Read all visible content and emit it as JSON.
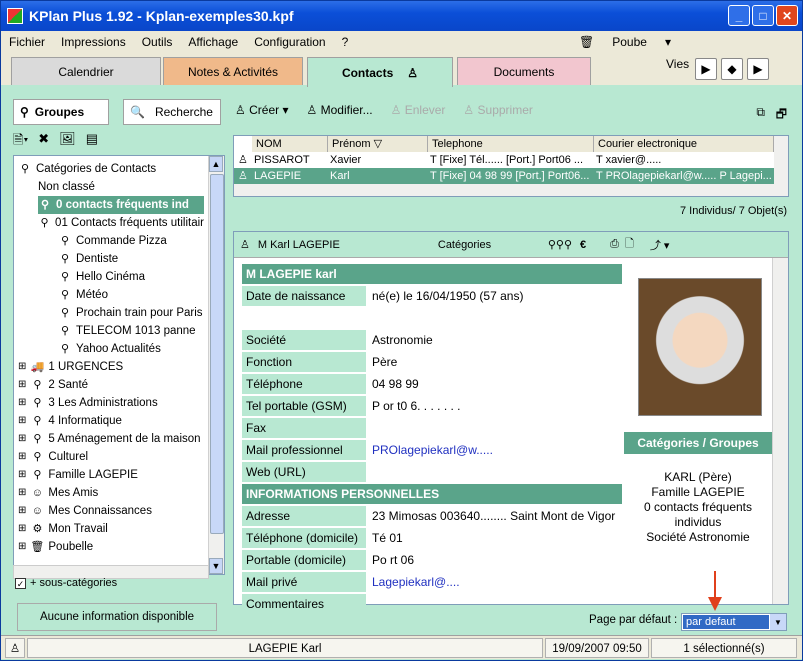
{
  "title": "KPlan Plus 1.92 - Kplan-exemples30.kpf",
  "menu": [
    "Fichier",
    "Impressions",
    "Outils",
    "Affichage",
    "Configuration",
    "?"
  ],
  "menu_right": {
    "poubelle": "Poube",
    "arrow": "▾"
  },
  "tabs": [
    "Calendrier",
    "Notes & Activités",
    "Contacts",
    "Documents"
  ],
  "vues_label": "Vies",
  "left": {
    "tab_groupes": "Groupes",
    "tab_recherche": "Recherche",
    "tree": [
      {
        "label": "Catégories de Contacts",
        "level": 0,
        "icon": "tag-icon"
      },
      {
        "label": "Non classé",
        "level": 1,
        "icon": ""
      },
      {
        "label": "0 contacts fréquents ind",
        "level": 1,
        "icon": "tag-icon",
        "selected": true
      },
      {
        "label": "01 Contacts  fréquents utilitair",
        "level": 1,
        "icon": "tag-icon"
      },
      {
        "label": "Commande Pizza",
        "level": 2,
        "icon": "tag-icon"
      },
      {
        "label": "Dentiste",
        "level": 2,
        "icon": "tag-icon"
      },
      {
        "label": "Hello Cinéma",
        "level": 2,
        "icon": "tag-icon"
      },
      {
        "label": "Météo",
        "level": 2,
        "icon": "tag-icon"
      },
      {
        "label": "Prochain train pour Paris",
        "level": 2,
        "icon": "tag-icon"
      },
      {
        "label": "TELECOM 1013  panne",
        "level": 2,
        "icon": "tag-icon"
      },
      {
        "label": "Yahoo Actualités",
        "level": 2,
        "icon": "tag-icon"
      },
      {
        "label": "1 URGENCES",
        "level": 0,
        "icon": "truck-icon"
      },
      {
        "label": "2 Santé",
        "level": 0,
        "icon": "tag-icon"
      },
      {
        "label": "3  Les Administrations",
        "level": 0,
        "icon": "tag-icon"
      },
      {
        "label": "4 Informatique",
        "level": 0,
        "icon": "tag-icon"
      },
      {
        "label": "5 Aménagement de la maison",
        "level": 0,
        "icon": "tag-icon"
      },
      {
        "label": "Culturel",
        "level": 0,
        "icon": "tag-icon"
      },
      {
        "label": "Famille LAGEPIE",
        "level": 0,
        "icon": "tag-icon"
      },
      {
        "label": "Mes Amis",
        "level": 0,
        "icon": "people-icon"
      },
      {
        "label": "Mes Connaissances",
        "level": 0,
        "icon": "people-icon"
      },
      {
        "label": "Mon Travail",
        "level": 0,
        "icon": "gear-icon"
      },
      {
        "label": "Poubelle",
        "level": 0,
        "icon": "trash-icon"
      }
    ],
    "subcat_label": "+ sous-catégories",
    "no_info": "Aucune information disponible"
  },
  "toolbar": {
    "creer": "Créer",
    "modifier": "Modifier...",
    "enlever": "Enlever",
    "supprimer": "Supprimer"
  },
  "list": {
    "headers": [
      "NOM",
      "Prénom",
      "Telephone",
      "Courier electronique"
    ],
    "rows": [
      {
        "nom": "PISSAROT",
        "prenom": "Xavier",
        "tel": "T [Fixe] Tél...... [Port.] Port06 ...",
        "mail": "T xavier@....."
      },
      {
        "nom": "LAGEPIE",
        "prenom": "Karl",
        "tel": "T [Fixe] 04 98 99 [Port.] Port06...",
        "mail": "T PROlagepiekarl@w..... P Lagepi..."
      }
    ],
    "count": "7 Individus/ 7 Objet(s)"
  },
  "card": {
    "header_name": "M Karl LAGEPIE",
    "header_cat": "Catégories",
    "header_euro": "€",
    "title": "M LAGEPIE karl",
    "fields": [
      {
        "label": "Date de naissance",
        "value": "né(e) le 16/04/1950 (57 ans)"
      },
      {
        "label": "Société",
        "value": "Astronomie"
      },
      {
        "label": "Fonction",
        "value": "Père"
      },
      {
        "label": "Téléphone",
        "value": "04 98 99"
      },
      {
        "label": "Tel portable (GSM)",
        "value": "P or t0 6. . .  . . . ."
      },
      {
        "label": "Fax",
        "value": ""
      },
      {
        "label": "Mail professionnel",
        "value": "PROlagepiekarl@w....."
      },
      {
        "label": "Web (URL)",
        "value": ""
      }
    ],
    "perso_header": "INFORMATIONS PERSONNELLES",
    "perso": [
      {
        "label": "Adresse",
        "value": "23 Mimosas 003640........ Saint Mont de Vigor"
      },
      {
        "label": "Téléphone (domicile)",
        "value": "Té 01"
      },
      {
        "label": "Portable (domicile)",
        "value": "Po rt 06"
      },
      {
        "label": "Mail privé",
        "value": "Lagepiekarl@...."
      },
      {
        "label": "Commentaires",
        "value": ""
      }
    ],
    "cat_title": "Catégories / Groupes",
    "cat_lines": [
      "KARL (Père)",
      "Famille LAGEPIE",
      "0 contacts fréquents",
      "individus",
      "Société Astronomie"
    ]
  },
  "page_default": {
    "label": "Page par défaut :",
    "value": "par defaut"
  },
  "status": {
    "name": "LAGEPIE Karl",
    "datetime": "19/09/2007 09:50",
    "selected": "1 sélectionné(s)"
  }
}
